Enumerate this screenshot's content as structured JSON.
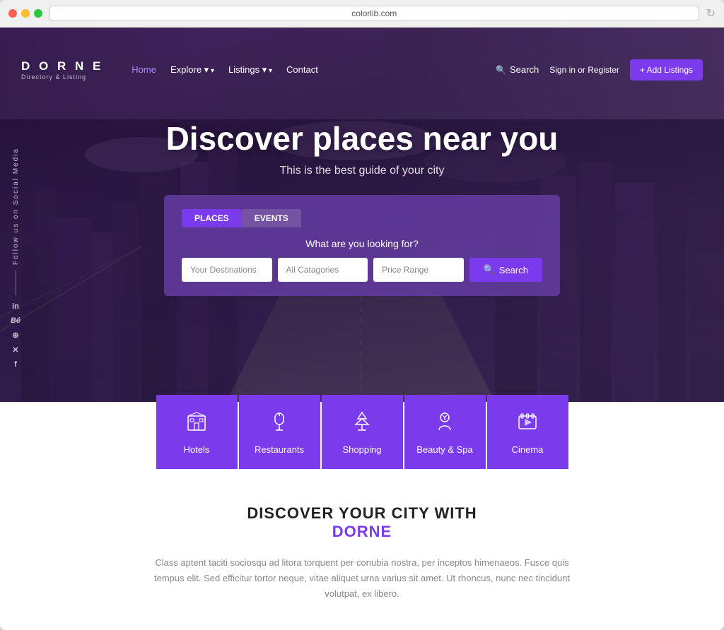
{
  "browser": {
    "url": "colorlib.com",
    "refresh_icon": "↻"
  },
  "navbar": {
    "logo_title": "D O R N E",
    "logo_sub": "Directory & Listing",
    "links": [
      {
        "label": "Home",
        "active": true
      },
      {
        "label": "Explore",
        "has_dropdown": true
      },
      {
        "label": "Listings",
        "has_dropdown": true
      },
      {
        "label": "Contact",
        "has_dropdown": false
      }
    ],
    "search_label": "Search",
    "auth_label": "Sign in or Register",
    "add_btn_label": "+ Add Listings"
  },
  "hero": {
    "title": "Discover places near you",
    "subtitle": "This is the best guide of your city",
    "social_label": "Follow us on Social Media"
  },
  "search": {
    "tabs": [
      {
        "label": "PLACES",
        "active": true
      },
      {
        "label": "EVENTS",
        "active": false
      }
    ],
    "prompt": "What are you looking for?",
    "destination_placeholder": "Your Destinations",
    "category_placeholder": "All Catagories",
    "price_placeholder": "Price Range",
    "search_btn": "Search"
  },
  "social_icons": [
    {
      "label": "in"
    },
    {
      "label": "Bé"
    },
    {
      "label": "⊕"
    },
    {
      "label": "𝕏"
    },
    {
      "label": "f"
    }
  ],
  "categories": [
    {
      "label": "Hotels",
      "icon": "🏨"
    },
    {
      "label": "Restaurants",
      "icon": "🍽"
    },
    {
      "label": "Shopping",
      "icon": "💎"
    },
    {
      "label": "Beauty & Spa",
      "icon": "💆"
    },
    {
      "label": "Cinema",
      "icon": "🎬"
    }
  ],
  "discover": {
    "line1": "DISCOVER YOUR CITY WITH",
    "brand": "DORNE",
    "body": "Class aptent taciti sociosqu ad litora torquent per conubia nostra, per inceptos himenaeos. Fusce quis tempus elit. Sed efficitur tortor neque, vitae aliquet urna varius sit amet. Ut rhoncus, nunc nec tincidunt volutpat, ex libero."
  }
}
